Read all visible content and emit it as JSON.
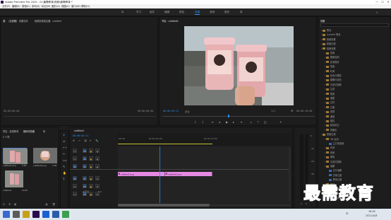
{
  "titlebar": {
    "title": "Adobe Premiere Pro 2020 - D:\\最需教育\\视频\\最需教育 *",
    "min": "—",
    "max": "☐",
    "close": "✕"
  },
  "menu": [
    "文件(F)",
    "编辑(E)",
    "剪辑(C)",
    "序列(S)",
    "标记(M)",
    "图形(G)",
    "视图(V)",
    "窗口(W)",
    "帮助(H)"
  ],
  "workspace": {
    "tabs": [
      "学习",
      "组件",
      "编辑",
      "颜色",
      "效果",
      "音频",
      "图形",
      "库"
    ],
    "active_index": 4
  },
  "source": {
    "tab": "源：（无剪辑）",
    "tab2": "效果控件",
    "tab3": "音频剪辑混合器：untitled",
    "tc_left": "00;00;00;00",
    "tc_right": "00;00;00;00"
  },
  "program": {
    "tab": "节目：untitled1",
    "tc_left": "00:00:04:11",
    "fit": "适合",
    "ratio": "1/2",
    "tc_right": "00:00:10:00"
  },
  "effects": {
    "tab": "效果",
    "search_placeholder": "",
    "items": [
      {
        "label": "预设",
        "type": "folder",
        "indent": 0
      },
      {
        "label": "Lumetri 预设",
        "type": "folder",
        "indent": 0
      },
      {
        "label": "音频效果",
        "type": "folder",
        "indent": 0
      },
      {
        "label": "音频过渡",
        "type": "folder",
        "indent": 0
      },
      {
        "label": "视频效果",
        "type": "folder",
        "indent": 0
      },
      {
        "label": "变换",
        "type": "folder",
        "indent": 1
      },
      {
        "label": "图像控制",
        "type": "folder",
        "indent": 1
      },
      {
        "label": "实用程序",
        "type": "folder",
        "indent": 1
      },
      {
        "label": "扭曲",
        "type": "folder",
        "indent": 1
      },
      {
        "label": "时间",
        "type": "folder",
        "indent": 1
      },
      {
        "label": "杂色与颗粒",
        "type": "folder",
        "indent": 1
      },
      {
        "label": "模糊与锐化",
        "type": "folder",
        "indent": 1
      },
      {
        "label": "沉浸式视频",
        "type": "folder",
        "indent": 1
      },
      {
        "label": "生成",
        "type": "folder",
        "indent": 1
      },
      {
        "label": "视频",
        "type": "folder",
        "indent": 1
      },
      {
        "label": "调整",
        "type": "folder",
        "indent": 1
      },
      {
        "label": "过时",
        "type": "folder",
        "indent": 1
      },
      {
        "label": "过渡",
        "type": "folder",
        "indent": 1
      },
      {
        "label": "透视",
        "type": "folder",
        "indent": 1
      },
      {
        "label": "通道",
        "type": "folder",
        "indent": 1
      },
      {
        "label": "键控",
        "type": "folder",
        "indent": 1
      },
      {
        "label": "颜色校正",
        "type": "folder",
        "indent": 1
      },
      {
        "label": "风格化",
        "type": "folder",
        "indent": 1
      },
      {
        "label": "视频过渡",
        "type": "folder",
        "indent": 0
      },
      {
        "label": "3D 运动",
        "type": "folder",
        "indent": 1
      },
      {
        "label": "立方体旋转",
        "type": "effect",
        "indent": 2
      },
      {
        "label": "内滑",
        "type": "folder",
        "indent": 1
      },
      {
        "label": "划像",
        "type": "folder",
        "indent": 1
      },
      {
        "label": "擦除",
        "type": "folder",
        "indent": 1
      },
      {
        "label": "沉浸式视频",
        "type": "folder",
        "indent": 1
      },
      {
        "label": "溶解",
        "type": "folder",
        "indent": 1
      },
      {
        "label": "交叉溶解",
        "type": "effect",
        "indent": 2
      },
      {
        "label": "白场过渡",
        "type": "effect",
        "indent": 2
      },
      {
        "label": "黑场过渡",
        "type": "effect",
        "indent": 2
      },
      {
        "label": "缩放",
        "type": "folder",
        "indent": 1
      },
      {
        "label": "页面剥落",
        "type": "folder",
        "indent": 1
      },
      {
        "label": "翻页",
        "type": "effect",
        "indent": 2
      },
      {
        "label": "页面剥落",
        "type": "effect",
        "indent": 2
      }
    ]
  },
  "project": {
    "tabs": [
      "项目：最需教育",
      "媒体浏览器",
      "库"
    ],
    "active_index": 1,
    "count": "3 个项",
    "clips": [
      {
        "name": "untitled1.png",
        "dur": "5:00"
      },
      {
        "name": "untitled2.png",
        "dur": "5:00"
      },
      {
        "name": "untitled1",
        "dur": "10:00"
      }
    ]
  },
  "timeline": {
    "tab": "untitled1",
    "tc": "00:00:04:11",
    "ruler": [
      ":00:00",
      "00:00:05:00",
      "00:00:10:00"
    ],
    "tracks": [
      "V3",
      "V2",
      "V1",
      "A1",
      "A2",
      "A3"
    ],
    "master": "主声道",
    "master_val": "0.0",
    "clips": [
      {
        "label": "untitled1.png",
        "start": 0,
        "end": 5
      },
      {
        "label": "untitled2.png",
        "start": 5,
        "end": 10
      }
    ],
    "playhead": 4.44
  },
  "meters": {
    "db": [
      "0",
      "-12",
      "-24",
      "-36",
      "-48",
      "dB"
    ],
    "s": "S",
    "s2": "S"
  },
  "taskbar": {
    "time": "16:45",
    "date": "2021/10/8",
    "lang": "中"
  },
  "watermark": "最需教育",
  "colors": {
    "accent": "#2d8ceb",
    "clip": "#e58ae3",
    "playhead": "#2d8ceb"
  }
}
